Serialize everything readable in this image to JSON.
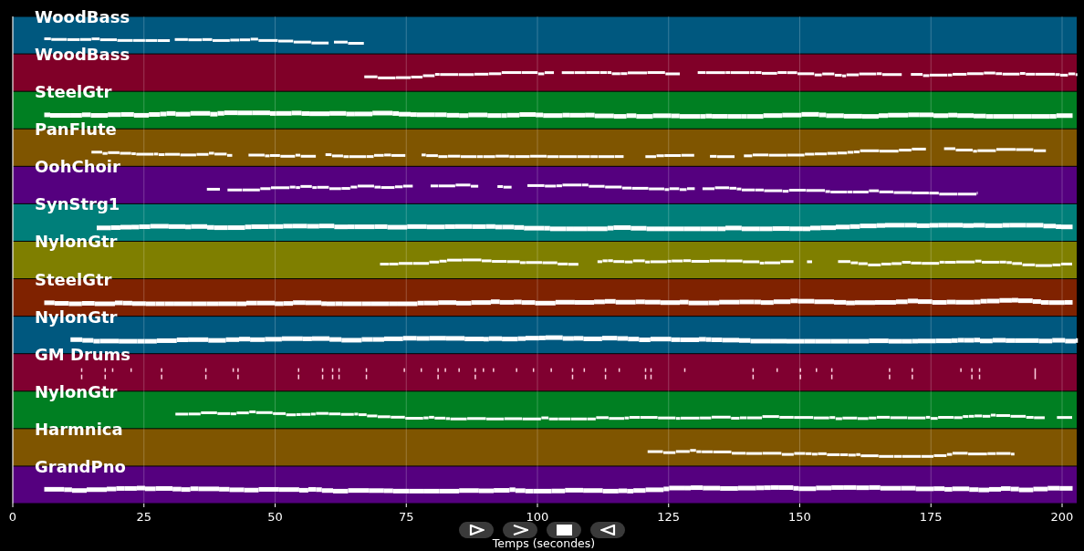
{
  "tracks": [
    {
      "name": "WoodBass",
      "color": "#00587f",
      "kind": "melody"
    },
    {
      "name": "WoodBass",
      "color": "#800028",
      "kind": "melody"
    },
    {
      "name": "SteelGtr",
      "color": "#007f22",
      "kind": "dense"
    },
    {
      "name": "PanFlute",
      "color": "#7f5500",
      "kind": "melody"
    },
    {
      "name": "OohChoir",
      "color": "#55007f",
      "kind": "melody"
    },
    {
      "name": "SynStrg1",
      "color": "#007f7a",
      "kind": "dense"
    },
    {
      "name": "NylonGtr",
      "color": "#7f7f00",
      "kind": "melody"
    },
    {
      "name": "SteelGtr",
      "color": "#7f2200",
      "kind": "dense"
    },
    {
      "name": "NylonGtr",
      "color": "#00587f",
      "kind": "dense"
    },
    {
      "name": "GM Drums",
      "color": "#800030",
      "kind": "drums"
    },
    {
      "name": "NylonGtr",
      "color": "#007f22",
      "kind": "melody"
    },
    {
      "name": "Harmnica",
      "color": "#7f5500",
      "kind": "melody"
    },
    {
      "name": "GrandPno",
      "color": "#55007f",
      "kind": "dense"
    }
  ],
  "x_axis": {
    "ticks": [
      "0",
      "25",
      "50",
      "75",
      "100",
      "125",
      "150",
      "175",
      "200"
    ],
    "label": "Temps (secondes)"
  }
}
